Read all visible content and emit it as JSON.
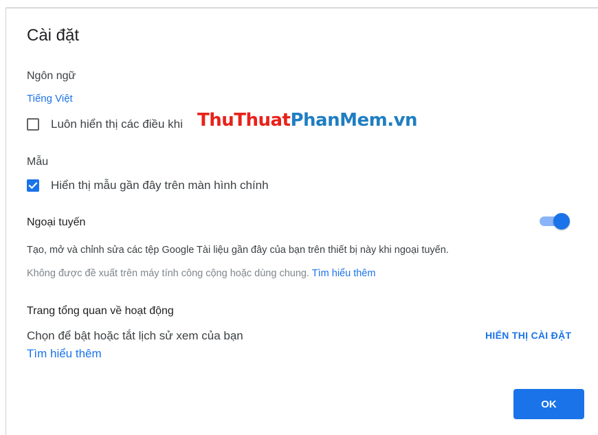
{
  "dialog": {
    "title": "Cài đặt",
    "ok_label": "OK"
  },
  "language": {
    "heading": "Ngôn ngữ",
    "current": "Tiếng Việt",
    "checkbox_label": "Luôn hiển thị các điều khi",
    "checkbox_checked": false
  },
  "templates": {
    "heading": "Mẫu",
    "checkbox_label": "Hiển thị mẫu gần đây trên màn hình chính",
    "checkbox_checked": true
  },
  "offline": {
    "heading": "Ngoại tuyến",
    "toggle_on": true,
    "description": "Tạo, mở và chỉnh sửa các tệp Google Tài liệu gần đây của bạn trên thiết bị này khi ngoại tuyến.",
    "warning": "Không được đề xuất trên máy tính công cộng hoặc dùng chung.",
    "learn_more": "Tìm hiểu thêm"
  },
  "activity": {
    "heading": "Trang tổng quan về hoạt động",
    "description": "Chọn để bật hoặc tắt lịch sử xem của bạn",
    "show_settings": "HIỂN THỊ CÀI ĐẶT",
    "learn_more": "Tìm hiểu thêm"
  },
  "watermark": {
    "part1": "ThuThuat",
    "part2": "PhanMem",
    "part3": ".vn"
  },
  "colors": {
    "accent": "#1a73e8",
    "toggle_track": "#8ab4f8",
    "watermark_red": "#e8221b",
    "watermark_blue": "#1f7ec2"
  }
}
